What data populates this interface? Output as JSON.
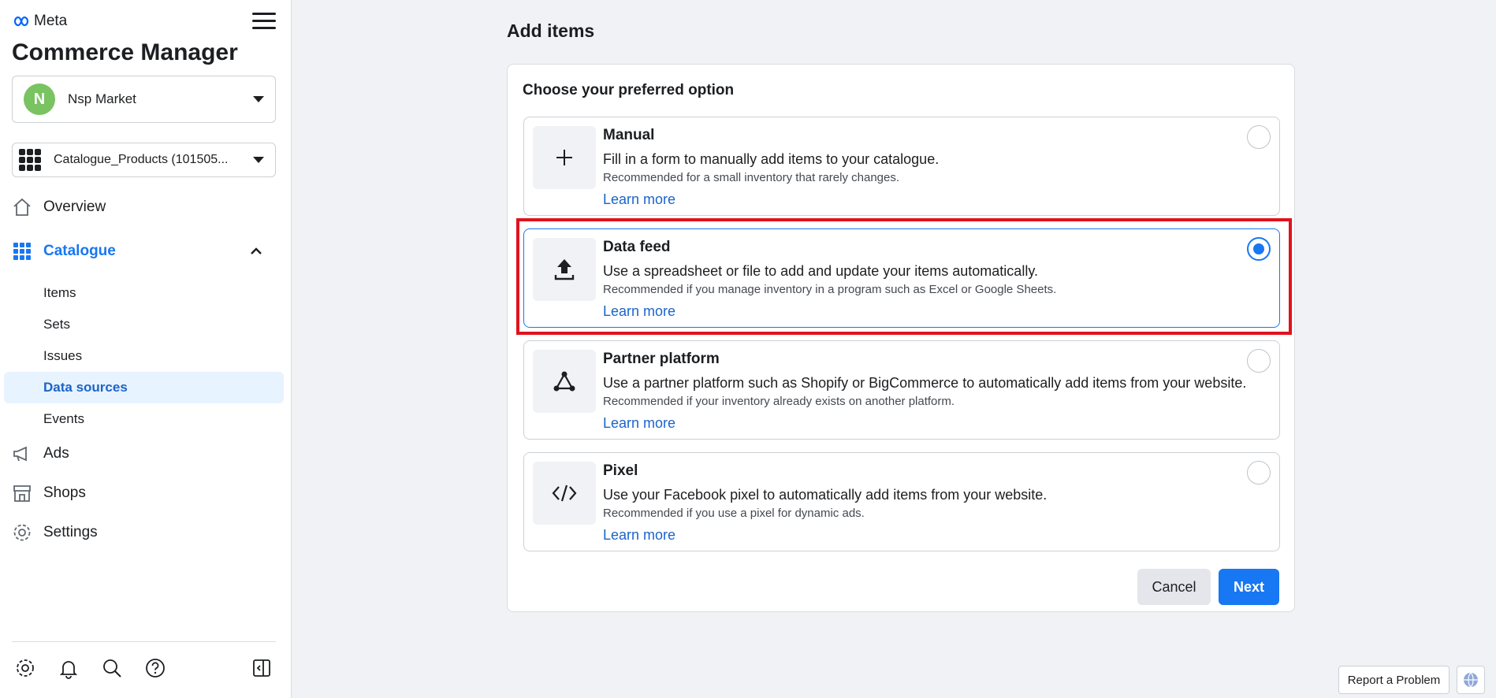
{
  "brand": {
    "logo_text": "Meta",
    "app_title": "Commerce Manager"
  },
  "account": {
    "initial": "N",
    "name": "Nsp Market"
  },
  "catalogue_selector": {
    "name": "Catalogue_Products (101505..."
  },
  "nav": {
    "overview": "Overview",
    "catalogue": "Catalogue",
    "catalogue_items": [
      "Items",
      "Sets",
      "Issues",
      "Data sources",
      "Events"
    ],
    "ads": "Ads",
    "shops": "Shops",
    "settings": "Settings"
  },
  "main": {
    "page_title": "Add items",
    "card_heading": "Choose your preferred option",
    "options": [
      {
        "title": "Manual",
        "description": "Fill in a form to manually add items to your catalogue.",
        "recommendation": "Recommended for a small inventory that rarely changes.",
        "link": "Learn more",
        "selected": false,
        "icon": "plus-icon"
      },
      {
        "title": "Data feed",
        "description": "Use a spreadsheet or file to add and update your items automatically.",
        "recommendation": "Recommended if you manage inventory in a program such as Excel or Google Sheets.",
        "link": "Learn more",
        "selected": true,
        "icon": "upload-icon"
      },
      {
        "title": "Partner platform",
        "description": "Use a partner platform such as Shopify or BigCommerce to automatically add items from your website.",
        "recommendation": "Recommended if your inventory already exists on another platform.",
        "link": "Learn more",
        "selected": false,
        "icon": "partner-network-icon"
      },
      {
        "title": "Pixel",
        "description": "Use your Facebook pixel to automatically add items from your website.",
        "recommendation": "Recommended if you use a pixel for dynamic ads.",
        "link": "Learn more",
        "selected": false,
        "icon": "code-icon"
      }
    ],
    "cancel_label": "Cancel",
    "next_label": "Next"
  },
  "footer": {
    "report_label": "Report a Problem"
  },
  "colors": {
    "accent": "#1877f2",
    "highlight": "#e0121f",
    "active_bg": "#e7f3ff"
  }
}
